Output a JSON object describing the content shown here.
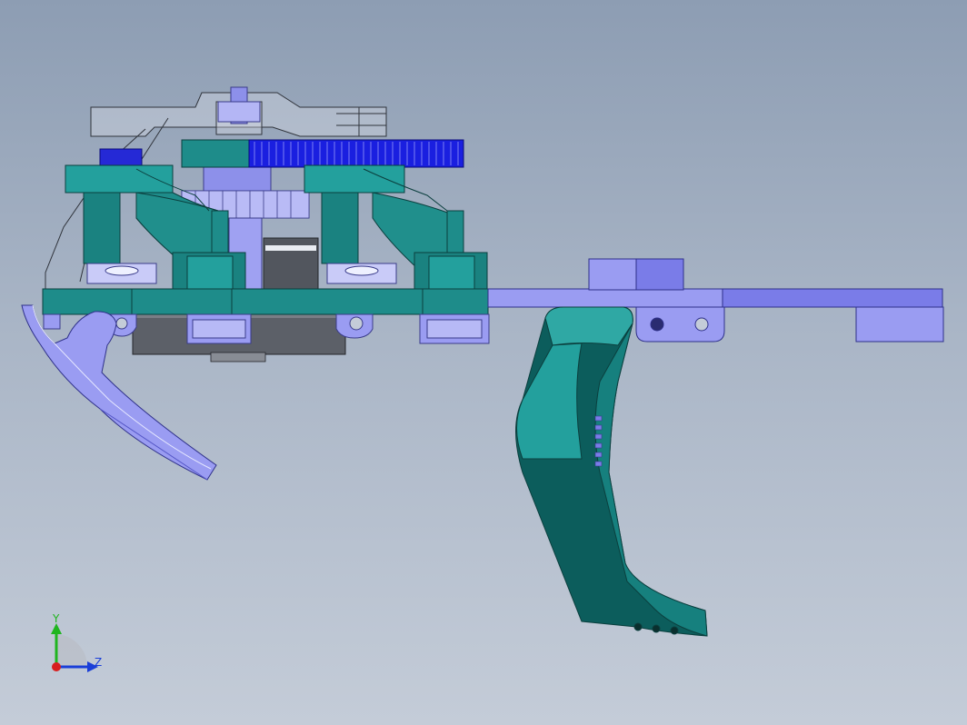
{
  "viewport": {
    "background_top": "#8d9db3",
    "background_bottom": "#c4ccd8"
  },
  "colors": {
    "teal": "#1e8c8a",
    "teal_dark": "#0c5d5c",
    "teal_light": "#2fa8a4",
    "lavender": "#9a9cf2",
    "lavender_dark": "#6f71d8",
    "blue_gear": "#1a1fe0",
    "gray": "#6a6e78",
    "gray_dark": "#3f4248",
    "ghost": "#d8dce6"
  },
  "triad": {
    "y_label": "Y",
    "z_label": "Z",
    "y_color": "#1fb51f",
    "z_color": "#1a3ed8",
    "origin_color": "#d81f1f"
  }
}
